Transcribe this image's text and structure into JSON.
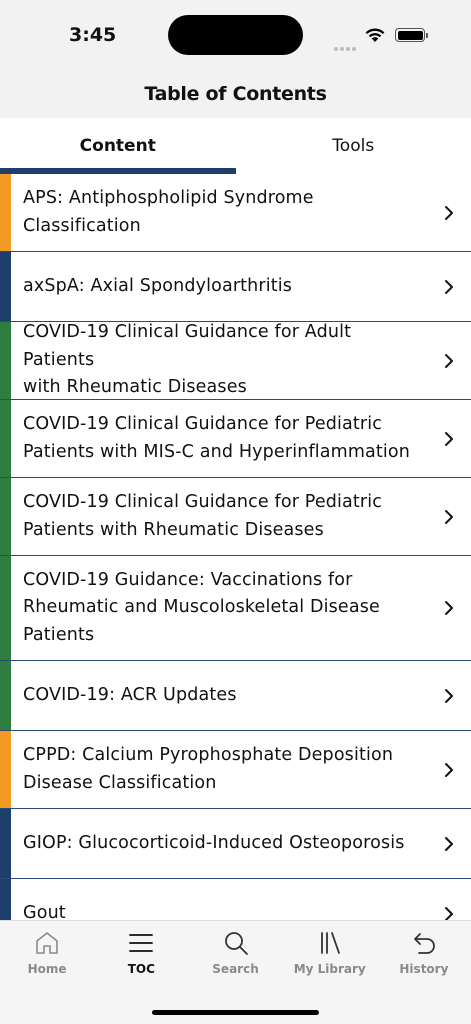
{
  "status": {
    "time": "3:45"
  },
  "header": {
    "title": "Table of Contents"
  },
  "tabs": [
    {
      "label": "Content",
      "active": true
    },
    {
      "label": "Tools",
      "active": false
    }
  ],
  "items": [
    {
      "label": "APS: Antiphospholipid Syndrome Classification",
      "lines": [
        "APS: Antiphospholipid Syndrome",
        "Classification"
      ],
      "color": "#f39a25"
    },
    {
      "label": "axSpA: Axial Spondyloarthritis",
      "lines": [
        "axSpA: Axial Spondyloarthritis"
      ],
      "color": "#1e3e6b"
    },
    {
      "label": "COVID-19 Clinical Guidance for Adult Patients with Rheumatic Diseases",
      "lines": [
        "COVID-19 Clinical Guidance for Adult Patients",
        "with Rheumatic Diseases"
      ],
      "color": "#2e7d3e"
    },
    {
      "label": "COVID-19 Clinical Guidance for Pediatric Patients with MIS-C and Hyperinflammation",
      "lines": [
        "COVID-19 Clinical Guidance for Pediatric",
        "Patients with MIS-C and Hyperinflammation"
      ],
      "color": "#2e7d3e"
    },
    {
      "label": "COVID-19 Clinical Guidance for Pediatric Patients with Rheumatic Diseases",
      "lines": [
        "COVID-19 Clinical Guidance for Pediatric",
        "Patients with Rheumatic Diseases"
      ],
      "color": "#2e7d3e"
    },
    {
      "label": "COVID-19 Guidance: Vaccinations for Rheumatic and Muscoloskeletal Disease Patients",
      "lines": [
        "COVID-19 Guidance: Vaccinations for",
        "Rheumatic and Muscoloskeletal Disease",
        "Patients"
      ],
      "color": "#2e7d3e"
    },
    {
      "label": "COVID-19: ACR Updates",
      "lines": [
        "COVID-19: ACR Updates"
      ],
      "color": "#2e7d3e"
    },
    {
      "label": "CPPD: Calcium Pyrophosphate Deposition Disease Classification",
      "lines": [
        "CPPD: Calcium Pyrophosphate Deposition",
        "Disease Classification"
      ],
      "color": "#f39a25"
    },
    {
      "label": "GIOP: Glucocorticoid-Induced Osteoporosis",
      "lines": [
        "GIOP: Glucocorticoid-Induced Osteoporosis"
      ],
      "color": "#1e3e6b"
    },
    {
      "label": "Gout",
      "lines": [
        "Gout"
      ],
      "color": "#1e3e6b"
    }
  ],
  "tabbar": [
    {
      "label": "Home",
      "icon": "home-icon",
      "active": false
    },
    {
      "label": "TOC",
      "icon": "list-icon",
      "active": true
    },
    {
      "label": "Search",
      "icon": "search-icon",
      "active": false
    },
    {
      "label": "My Library",
      "icon": "library-icon",
      "active": false
    },
    {
      "label": "History",
      "icon": "history-icon",
      "active": false
    }
  ]
}
